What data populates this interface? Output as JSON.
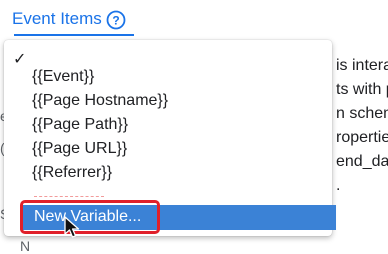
{
  "field": {
    "title": "Event Items"
  },
  "icons": {
    "help": "help-circle-icon",
    "cursor": "mouse-pointer-icon",
    "check": "checkmark-icon"
  },
  "dropdown": {
    "check_glyph": "✓",
    "items": [
      "{{Event}}",
      "{{Page Hostname}}",
      "{{Page Path}}",
      "{{Page URL}}",
      "{{Referrer}}"
    ],
    "new_variable_label": "New Variable..."
  },
  "background": {
    "lines": [
      "is intera",
      "ts with p",
      "n schem",
      "ropertie",
      "end_dat",
      "."
    ],
    "left_fragments": [
      "e",
      "(",
      "S"
    ],
    "bottom_fragment": "N"
  },
  "colors": {
    "accent": "#1a73e8",
    "selection": "#3b82d6",
    "highlight": "#e0202a"
  }
}
